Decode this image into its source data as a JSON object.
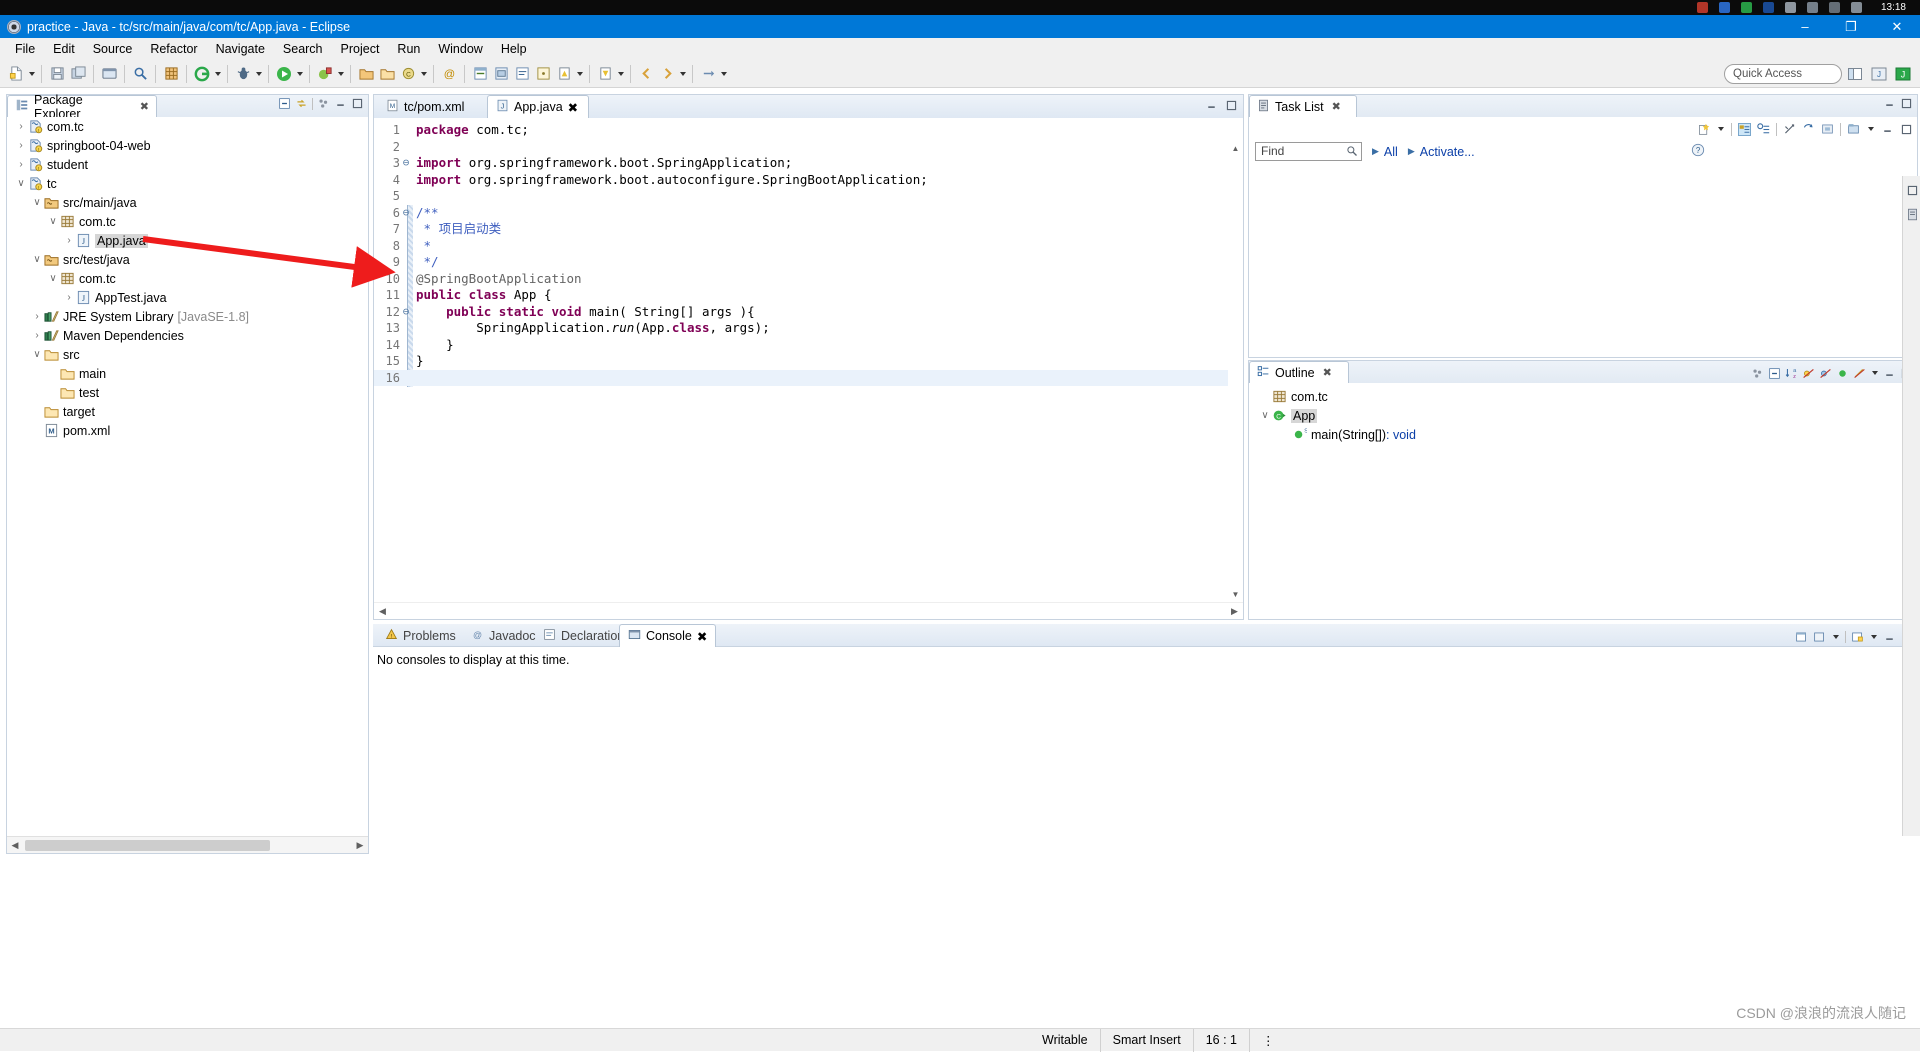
{
  "os": {
    "clock": "13:18"
  },
  "window": {
    "title": "practice - Java - tc/src/main/java/com/tc/App.java - Eclipse",
    "minimize": "–",
    "maximize": "❐",
    "close": "✕"
  },
  "menu": [
    {
      "label": "File"
    },
    {
      "label": "Edit"
    },
    {
      "label": "Source"
    },
    {
      "label": "Refactor"
    },
    {
      "label": "Navigate"
    },
    {
      "label": "Search"
    },
    {
      "label": "Project"
    },
    {
      "label": "Run"
    },
    {
      "label": "Window"
    },
    {
      "label": "Help"
    }
  ],
  "toolbar": {
    "quick_access_placeholder": "Quick Access"
  },
  "package_explorer": {
    "title": "Package Explorer",
    "close": "✖",
    "tree": [
      {
        "label": "com.tc",
        "indent": 0,
        "twisty": "›",
        "icon": "java-project-icon",
        "selected": false
      },
      {
        "label": "springboot-04-web",
        "indent": 0,
        "twisty": "›",
        "icon": "java-project-icon",
        "selected": false
      },
      {
        "label": "student",
        "indent": 0,
        "twisty": "›",
        "icon": "java-project-icon",
        "selected": false
      },
      {
        "label": "tc",
        "indent": 0,
        "twisty": "∨",
        "icon": "java-project-icon",
        "selected": false
      },
      {
        "label": "src/main/java",
        "indent": 1,
        "twisty": "∨",
        "icon": "source-folder-icon",
        "selected": false
      },
      {
        "label": "com.tc",
        "indent": 2,
        "twisty": "∨",
        "icon": "package-icon",
        "selected": false
      },
      {
        "label": "App.java",
        "indent": 3,
        "twisty": "›",
        "icon": "java-file-icon",
        "selected": true
      },
      {
        "label": "src/test/java",
        "indent": 1,
        "twisty": "∨",
        "icon": "source-folder-icon",
        "selected": false
      },
      {
        "label": "com.tc",
        "indent": 2,
        "twisty": "∨",
        "icon": "package-icon",
        "selected": false
      },
      {
        "label": "AppTest.java",
        "indent": 3,
        "twisty": "›",
        "icon": "java-file-icon",
        "selected": false
      },
      {
        "label": "JRE System Library",
        "suffix": "[JavaSE-1.8]",
        "indent": 1,
        "twisty": "›",
        "icon": "library-icon",
        "selected": false
      },
      {
        "label": "Maven Dependencies",
        "indent": 1,
        "twisty": "›",
        "icon": "library-icon",
        "selected": false
      },
      {
        "label": "src",
        "indent": 1,
        "twisty": "∨",
        "icon": "folder-icon",
        "selected": false
      },
      {
        "label": "main",
        "indent": 2,
        "twisty": "",
        "icon": "folder-icon",
        "selected": false
      },
      {
        "label": "test",
        "indent": 2,
        "twisty": "",
        "icon": "folder-icon",
        "selected": false
      },
      {
        "label": "target",
        "indent": 1,
        "twisty": "",
        "icon": "folder-icon",
        "selected": false
      },
      {
        "label": "pom.xml",
        "indent": 1,
        "twisty": "",
        "icon": "maven-pom-icon",
        "selected": false
      }
    ]
  },
  "editor": {
    "tabs": [
      {
        "label": "tc/pom.xml",
        "icon": "maven-pom-icon",
        "active": false,
        "closable": false
      },
      {
        "label": "App.java",
        "icon": "java-file-icon",
        "active": true,
        "closable": true,
        "close": "✖"
      }
    ],
    "lines": [
      {
        "no": "1",
        "fold": "",
        "current": false,
        "tokens": [
          {
            "t": "package ",
            "c": "kw"
          },
          {
            "t": "com.tc;",
            "c": "plain"
          }
        ]
      },
      {
        "no": "2",
        "fold": "",
        "current": false,
        "tokens": []
      },
      {
        "no": "3",
        "fold": "⊖",
        "current": false,
        "tokens": [
          {
            "t": "import ",
            "c": "kw"
          },
          {
            "t": "org.springframework.boot.SpringApplication;",
            "c": "plain"
          }
        ]
      },
      {
        "no": "4",
        "fold": "",
        "current": false,
        "tokens": [
          {
            "t": "import ",
            "c": "kw"
          },
          {
            "t": "org.springframework.boot.autoconfigure.SpringBootApplication;",
            "c": "plain"
          }
        ]
      },
      {
        "no": "5",
        "fold": "",
        "current": false,
        "tokens": []
      },
      {
        "no": "6",
        "fold": "⊖",
        "current": false,
        "tokens": [
          {
            "t": "/**",
            "c": "cmt"
          }
        ]
      },
      {
        "no": "7",
        "fold": "",
        "current": false,
        "tokens": [
          {
            "t": " * 项目启动类",
            "c": "cmt"
          }
        ]
      },
      {
        "no": "8",
        "fold": "",
        "current": false,
        "tokens": [
          {
            "t": " *",
            "c": "cmt"
          }
        ]
      },
      {
        "no": "9",
        "fold": "",
        "current": false,
        "tokens": [
          {
            "t": " */",
            "c": "cmt"
          }
        ]
      },
      {
        "no": "10",
        "fold": "",
        "current": false,
        "tokens": [
          {
            "t": "@SpringBootApplication",
            "c": "ann"
          }
        ]
      },
      {
        "no": "11",
        "fold": "",
        "current": false,
        "tokens": [
          {
            "t": "public class ",
            "c": "kw"
          },
          {
            "t": "App {",
            "c": "plain"
          }
        ]
      },
      {
        "no": "12",
        "fold": "⊖",
        "current": false,
        "tokens": [
          {
            "t": "    public static void ",
            "c": "kw"
          },
          {
            "t": "main( String[] args ){",
            "c": "plain"
          }
        ]
      },
      {
        "no": "13",
        "fold": "",
        "current": false,
        "tokens": [
          {
            "t": "        SpringApplication.",
            "c": "plain"
          },
          {
            "t": "run",
            "c": "stat"
          },
          {
            "t": "(App.",
            "c": "plain"
          },
          {
            "t": "class",
            "c": "kw"
          },
          {
            "t": ", args);",
            "c": "plain"
          }
        ]
      },
      {
        "no": "14",
        "fold": "",
        "current": false,
        "tokens": [
          {
            "t": "    }",
            "c": "plain"
          }
        ]
      },
      {
        "no": "15",
        "fold": "",
        "current": false,
        "tokens": [
          {
            "t": "}",
            "c": "plain"
          }
        ]
      },
      {
        "no": "16",
        "fold": "",
        "current": true,
        "tokens": []
      }
    ]
  },
  "console": {
    "tabs": [
      {
        "label": "Problems",
        "icon": "problems-icon",
        "active": false
      },
      {
        "label": "Javadoc",
        "icon": "javadoc-icon",
        "active": false
      },
      {
        "label": "Declaration",
        "icon": "declaration-icon",
        "active": false
      },
      {
        "label": "Console",
        "icon": "console-icon",
        "active": true,
        "close": "✖"
      }
    ],
    "message": "No consoles to display at this time."
  },
  "task_list": {
    "title": "Task List",
    "close": "✖",
    "find_placeholder": "Find",
    "all_label": "All",
    "activate_label": "Activate...",
    "help_label": "?"
  },
  "outline": {
    "title": "Outline",
    "close": "✖",
    "rows": [
      {
        "label": "com.tc",
        "indent": 0,
        "twisty": "",
        "icon": "package-icon",
        "selected": false,
        "type": ""
      },
      {
        "label": "App",
        "indent": 0,
        "twisty": "∨",
        "icon": "class-icon",
        "selected": true,
        "type": ""
      },
      {
        "label": "main(String[])",
        "indent": 1,
        "twisty": "",
        "icon": "method-icon",
        "selected": false,
        "type": " : void"
      }
    ]
  },
  "status_bar": {
    "writable": "Writable",
    "insert_mode": "Smart Insert",
    "position": "16 : 1"
  },
  "watermark": "CSDN @浪浪的流浪人随记",
  "colors": {
    "title_bar": "#0078d7",
    "accent_link": "#0b3fa8",
    "keyword": "#7f0055",
    "comment": "#3f5fbf",
    "annotation": "#646464",
    "arrow": "#ee1c1c",
    "selection": "#d6d6d6"
  }
}
